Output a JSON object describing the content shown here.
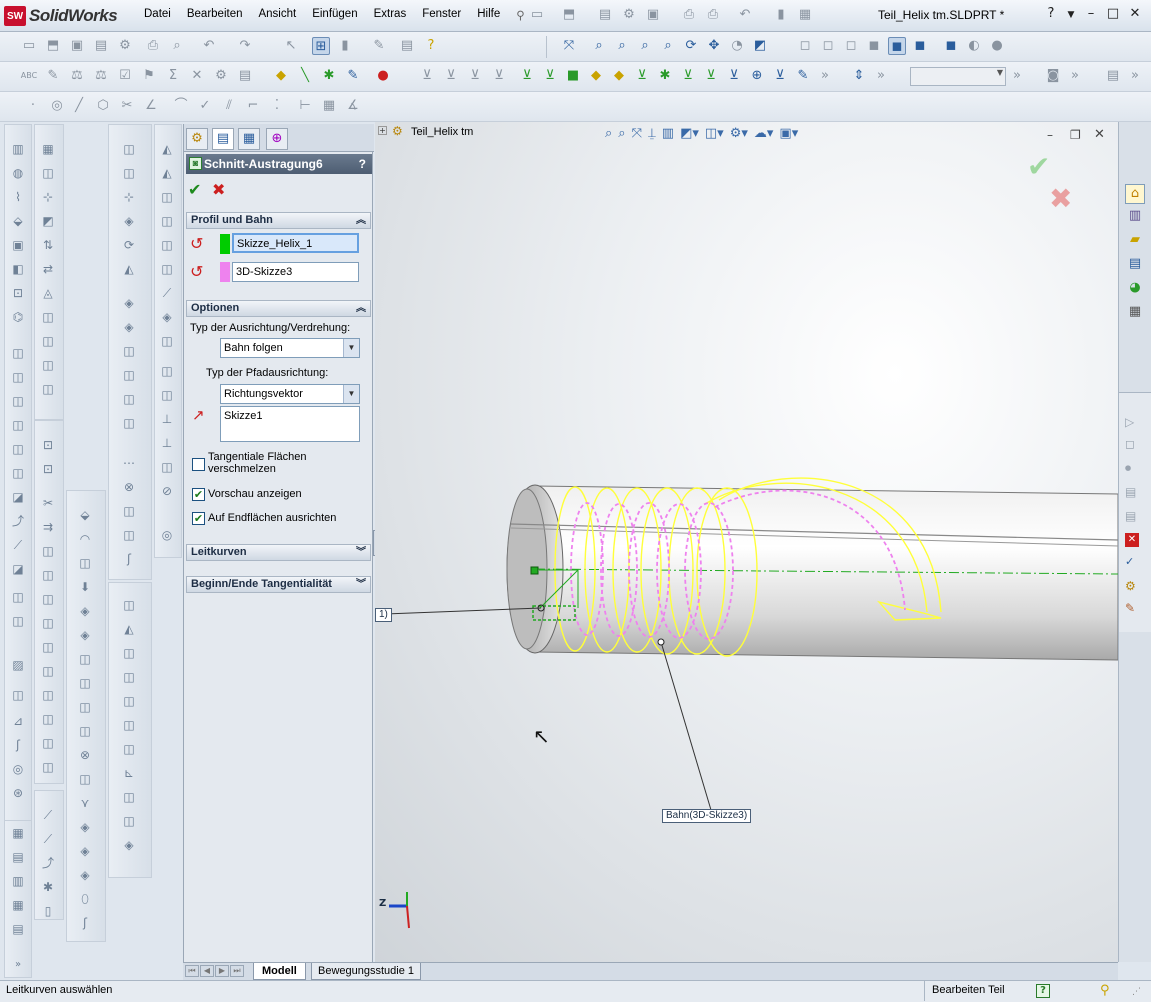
{
  "app": {
    "logo_text": "SolidWorks",
    "logo_mark": "SW",
    "doc_title": "Teil_Helix tm.SLDPRT *"
  },
  "menu": [
    "Datei",
    "Bearbeiten",
    "Ansicht",
    "Einfügen",
    "Extras",
    "Fenster",
    "Hilfe"
  ],
  "pm": {
    "title": "Schnitt-Austragung6",
    "help": "?",
    "group_profile": "Profil und Bahn",
    "profile_value": "Skizze_Helix_1",
    "path_value": "3D-Skizze3",
    "group_options": "Optionen",
    "orient_label": "Typ der Ausrichtung/Verdrehung:",
    "orient_value": "Bahn folgen",
    "path_orient_label": "Typ der Pfadausrichtung:",
    "path_orient_value": "Richtungsvektor",
    "direction_value": "Skizze1",
    "cb_tangent": "Tangentiale Flächen verschmelzen",
    "cb_preview": "Vorschau anzeigen",
    "cb_endfaces": "Auf Endflächen ausrichten",
    "group_guides": "Leitkurven",
    "group_tangency": "Beginn/Ende Tangentialität"
  },
  "viewport": {
    "tree_root": "Teil_Helix tm",
    "callout_path": "Bahn(3D-Skizze3)",
    "callout_profile": "1)",
    "axis_z": "Z"
  },
  "tabs": {
    "model": "Modell",
    "motion": "Bewegungsstudie 1"
  },
  "status": {
    "left": "Leitkurven auswählen",
    "mode": "Bearbeiten Teil",
    "help": "?"
  },
  "colors": {
    "helix": "#ffff3a",
    "path": "#ee82ee",
    "profile_swatch": "#00cc00",
    "path_swatch": "#ee82ee",
    "accent": "#2a5d9c"
  }
}
